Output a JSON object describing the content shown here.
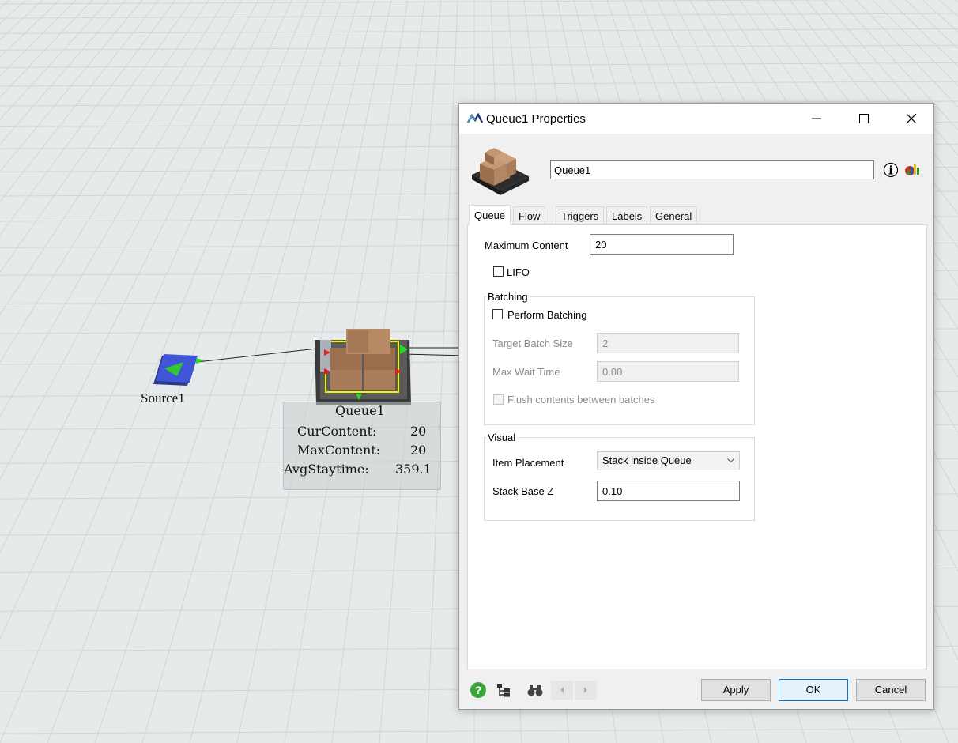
{
  "scene": {
    "source_label": "Source1",
    "queue_label": "Queue1",
    "stats": {
      "cur_content_label": "CurContent:",
      "cur_content_value": "20",
      "max_content_label": "MaxContent:",
      "max_content_value": "20",
      "avg_staytime_label": "AvgStaytime:",
      "avg_staytime_value": "359.1"
    }
  },
  "dialog": {
    "title": "Queue1  Properties",
    "name_value": "Queue1",
    "tabs": [
      {
        "label": "Queue",
        "active": true
      },
      {
        "label": "Flow",
        "active": false
      },
      {
        "label": "Triggers",
        "active": false
      },
      {
        "label": "Labels",
        "active": false
      },
      {
        "label": "General",
        "active": false
      }
    ],
    "queue_tab": {
      "max_content_label": "Maximum Content",
      "max_content_value": "20",
      "lifo_label": "LIFO",
      "lifo_checked": false,
      "batching": {
        "title": "Batching",
        "perform_batching_label": "Perform Batching",
        "perform_batching_checked": false,
        "target_batch_size_label": "Target Batch Size",
        "target_batch_size_value": "2",
        "max_wait_time_label": "Max Wait Time",
        "max_wait_time_value": "0.00",
        "flush_label": "Flush contents between batches",
        "flush_checked": false
      },
      "visual": {
        "title": "Visual",
        "item_placement_label": "Item Placement",
        "item_placement_value": "Stack inside Queue",
        "stack_base_z_label": "Stack Base Z",
        "stack_base_z_value": "0.10"
      }
    },
    "buttons": {
      "apply": "Apply",
      "ok": "OK",
      "cancel": "Cancel"
    },
    "icons": [
      "help-icon",
      "tree-icon",
      "find-icon",
      "prev-arrow-icon",
      "next-arrow-icon",
      "info-icon",
      "properties-icon"
    ]
  },
  "colors": {
    "ok_border": "#0078d7",
    "grid_bg": "#e7eaea",
    "source_blue": "#3b4ec9",
    "arrow_green": "#22cc22",
    "box_brown": "#a97c5a"
  }
}
